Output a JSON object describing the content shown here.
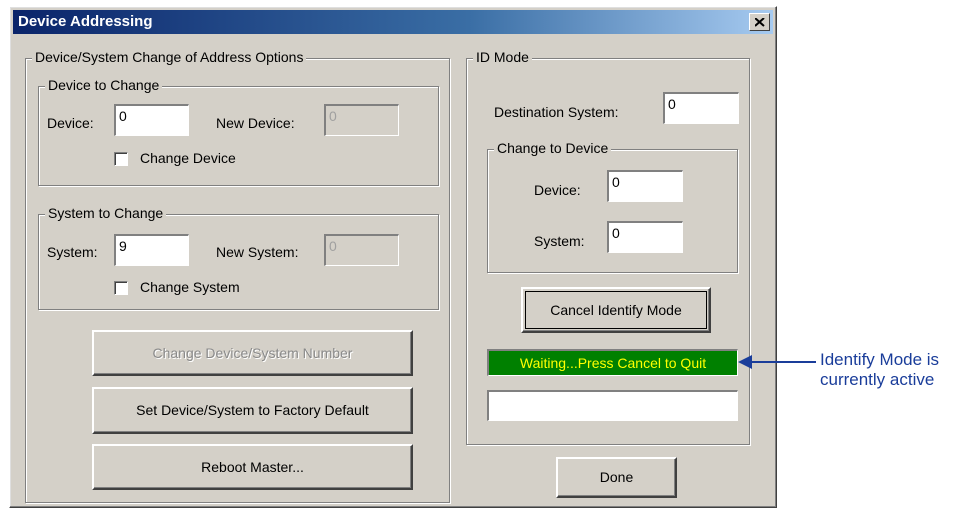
{
  "window": {
    "title": "Device Addressing",
    "close_icon": "close-x-icon"
  },
  "change_address": {
    "legend": "Device/System Change of Address Options",
    "device_group": {
      "legend": "Device to Change",
      "device_label": "Device:",
      "device_value": "0",
      "new_device_label": "New Device:",
      "new_device_value": "0",
      "checkbox_label": "Change Device",
      "checked": false
    },
    "system_group": {
      "legend": "System to Change",
      "system_label": "System:",
      "system_value": "9",
      "new_system_label": "New System:",
      "new_system_value": "0",
      "checkbox_label": "Change System",
      "checked": false
    },
    "change_number_button": "Change Device/System Number",
    "factory_default_button": "Set Device/System to Factory Default",
    "reboot_button": "Reboot Master..."
  },
  "id_mode": {
    "legend": "ID Mode",
    "destination_label": "Destination System:",
    "destination_value": "0",
    "change_to_device": {
      "legend": "Change to Device",
      "device_label": "Device:",
      "device_value": "0",
      "system_label": "System:",
      "system_value": "0"
    },
    "cancel_button": "Cancel Identify Mode",
    "status_text": "Waiting...Press Cancel to Quit",
    "status_bg": "#008000",
    "status_fg": "#ffff00",
    "extra_field_value": ""
  },
  "done_button": "Done",
  "callout": {
    "line1": "Identify Mode is",
    "line2": "currently active",
    "color": "#1a3d9a"
  }
}
